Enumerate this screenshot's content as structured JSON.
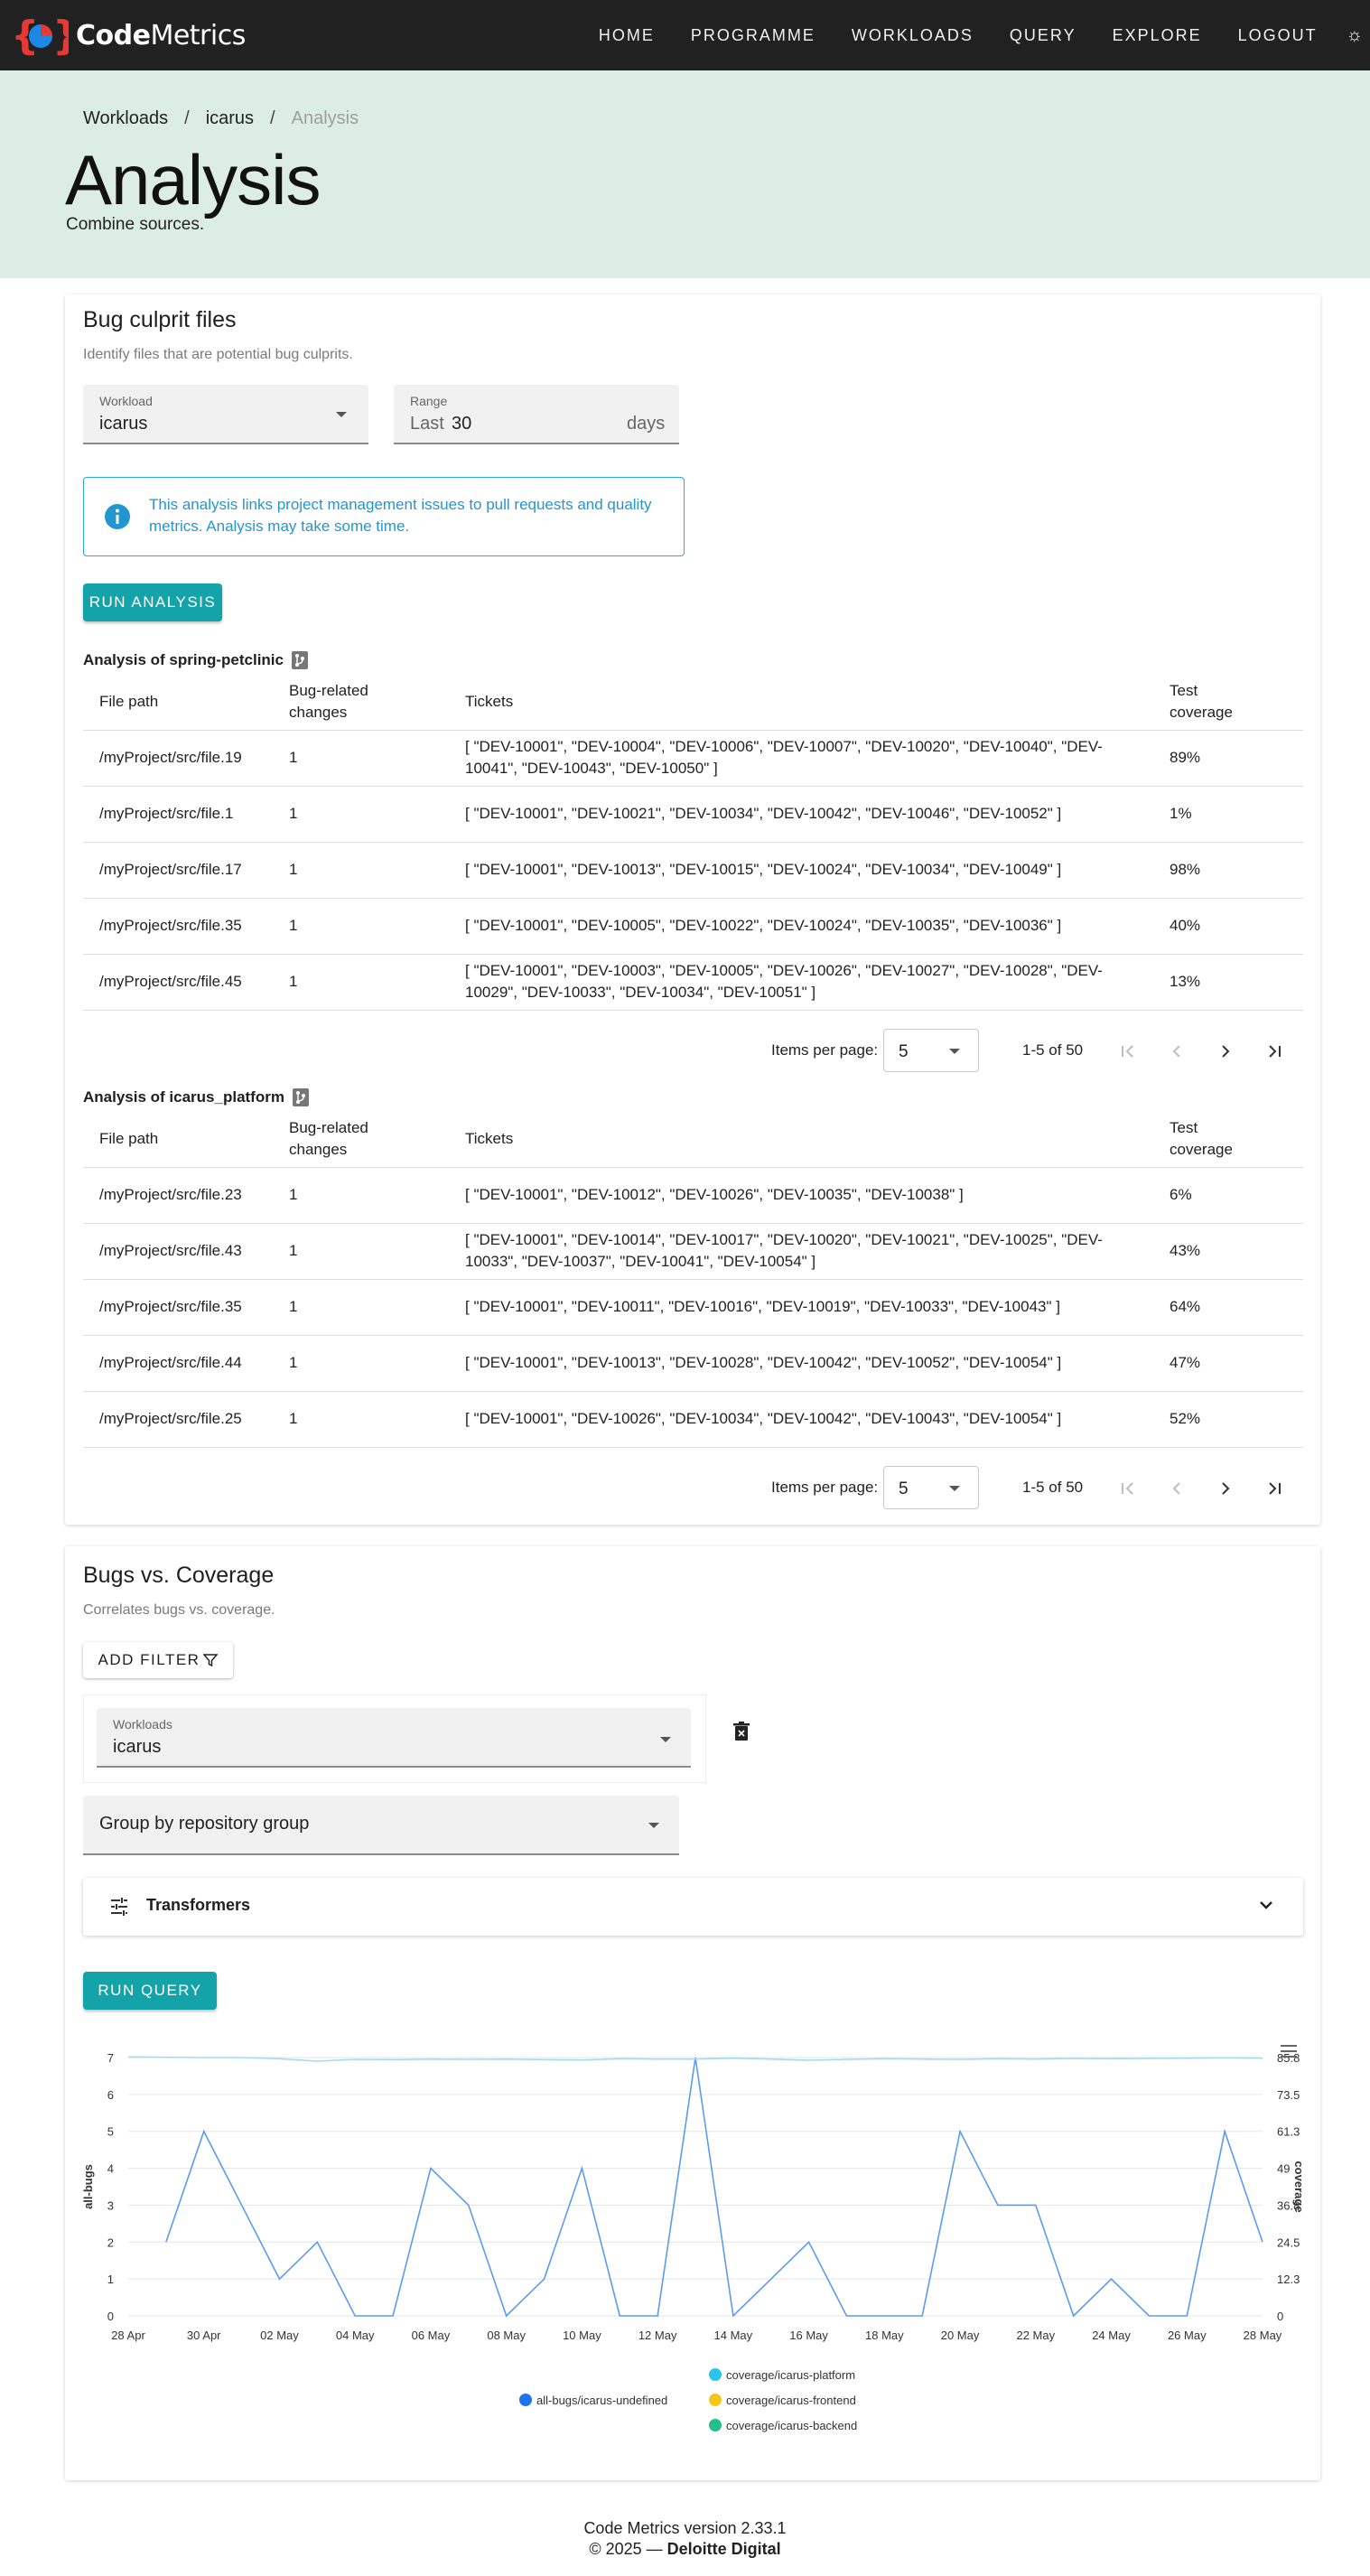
{
  "nav": {
    "brand": "CodeMetrics",
    "brand_bold": "Code",
    "brand_light": "Metrics",
    "links": [
      "HOME",
      "PROGRAMME",
      "WORKLOADS",
      "QUERY",
      "EXPLORE",
      "LOGOUT"
    ],
    "theme_icon": "sun-icon"
  },
  "breadcrumb": [
    "Workloads",
    "icarus",
    "Analysis"
  ],
  "page": {
    "title": "Analysis",
    "subtitle": "Combine sources."
  },
  "bug_culprit": {
    "title": "Bug culprit files",
    "subtitle": "Identify files that are potential bug culprits.",
    "workload": {
      "label": "Workload",
      "value": "icarus"
    },
    "range": {
      "label": "Range",
      "prefix": "Last",
      "value": "30",
      "suffix": "days"
    },
    "info": "This analysis links project management issues to pull requests and quality metrics. Analysis may take some time.",
    "run_label": "RUN ANALYSIS",
    "columns": {
      "path": "File path",
      "bug_line1": "Bug-related",
      "bug_line2": "changes",
      "tickets": "Tickets",
      "cov_line1": "Test",
      "cov_line2": "coverage"
    },
    "tables": [
      {
        "title": "Analysis of spring-petclinic",
        "rows": [
          {
            "path": "/myProject/src/file.19",
            "bugs": "1",
            "tickets": "[ \"DEV-10001\", \"DEV-10004\", \"DEV-10006\", \"DEV-10007\", \"DEV-10020\", \"DEV-10040\", \"DEV-10041\", \"DEV-10043\", \"DEV-10050\" ]",
            "coverage": "89%"
          },
          {
            "path": "/myProject/src/file.1",
            "bugs": "1",
            "tickets": "[ \"DEV-10001\", \"DEV-10021\", \"DEV-10034\", \"DEV-10042\", \"DEV-10046\", \"DEV-10052\" ]",
            "coverage": "1%"
          },
          {
            "path": "/myProject/src/file.17",
            "bugs": "1",
            "tickets": "[ \"DEV-10001\", \"DEV-10013\", \"DEV-10015\", \"DEV-10024\", \"DEV-10034\", \"DEV-10049\" ]",
            "coverage": "98%"
          },
          {
            "path": "/myProject/src/file.35",
            "bugs": "1",
            "tickets": "[ \"DEV-10001\", \"DEV-10005\", \"DEV-10022\", \"DEV-10024\", \"DEV-10035\", \"DEV-10036\" ]",
            "coverage": "40%"
          },
          {
            "path": "/myProject/src/file.45",
            "bugs": "1",
            "tickets": "[ \"DEV-10001\", \"DEV-10003\", \"DEV-10005\", \"DEV-10026\", \"DEV-10027\", \"DEV-10028\", \"DEV-10029\", \"DEV-10033\", \"DEV-10034\", \"DEV-10051\" ]",
            "coverage": "13%"
          }
        ],
        "pager": {
          "label": "Items per page:",
          "per_page": "5",
          "range": "1-5 of 50"
        }
      },
      {
        "title": "Analysis of icarus_platform",
        "rows": [
          {
            "path": "/myProject/src/file.23",
            "bugs": "1",
            "tickets": "[ \"DEV-10001\", \"DEV-10012\", \"DEV-10026\", \"DEV-10035\", \"DEV-10038\" ]",
            "coverage": "6%"
          },
          {
            "path": "/myProject/src/file.43",
            "bugs": "1",
            "tickets": "[ \"DEV-10001\", \"DEV-10014\", \"DEV-10017\", \"DEV-10020\", \"DEV-10021\", \"DEV-10025\", \"DEV-10033\", \"DEV-10037\", \"DEV-10041\", \"DEV-10054\" ]",
            "coverage": "43%"
          },
          {
            "path": "/myProject/src/file.35",
            "bugs": "1",
            "tickets": "[ \"DEV-10001\", \"DEV-10011\", \"DEV-10016\", \"DEV-10019\", \"DEV-10033\", \"DEV-10043\" ]",
            "coverage": "64%"
          },
          {
            "path": "/myProject/src/file.44",
            "bugs": "1",
            "tickets": "[ \"DEV-10001\", \"DEV-10013\", \"DEV-10028\", \"DEV-10042\", \"DEV-10052\", \"DEV-10054\" ]",
            "coverage": "47%"
          },
          {
            "path": "/myProject/src/file.25",
            "bugs": "1",
            "tickets": "[ \"DEV-10001\", \"DEV-10026\", \"DEV-10034\", \"DEV-10042\", \"DEV-10043\", \"DEV-10054\" ]",
            "coverage": "52%"
          }
        ],
        "pager": {
          "label": "Items per page:",
          "per_page": "5",
          "range": "1-5 of 50"
        }
      }
    ]
  },
  "bugs_coverage": {
    "title": "Bugs vs. Coverage",
    "subtitle": "Correlates bugs vs. coverage.",
    "add_filter_label": "ADD FILTER",
    "workloads": {
      "label": "Workloads",
      "value": "icarus"
    },
    "group_by": "Group by repository group",
    "transformers_label": "Transformers",
    "run_label": "RUN QUERY"
  },
  "chart_data": {
    "type": "line",
    "x": [
      "29 Apr",
      "30 Apr",
      "1 May",
      "2 May",
      "3 May",
      "4 May",
      "5 May",
      "6 May",
      "7 May",
      "8 May",
      "9 May",
      "10 May",
      "11 May",
      "12 May",
      "13 May",
      "14 May",
      "15 May",
      "16 May",
      "17 May",
      "18 May",
      "19 May",
      "20 May",
      "21 May",
      "22 May",
      "23 May",
      "24 May",
      "25 May",
      "26 May",
      "27 May",
      "28 May"
    ],
    "x_ticks": [
      "28 Apr",
      "30 Apr",
      "02 May",
      "04 May",
      "06 May",
      "08 May",
      "10 May",
      "12 May",
      "14 May",
      "16 May",
      "18 May",
      "20 May",
      "22 May",
      "24 May",
      "26 May",
      "28 May"
    ],
    "series": [
      {
        "name": "all-bugs/icarus-undefined",
        "axis": "left",
        "color": "#5b9bef",
        "values": [
          2,
          5,
          3,
          1,
          2,
          0,
          0,
          4,
          3,
          0,
          1,
          4,
          0,
          0,
          7,
          0,
          1,
          2,
          0,
          0,
          0,
          5,
          3,
          3,
          0,
          1,
          0,
          0,
          5,
          2
        ]
      },
      {
        "name": "coverage/icarus-platform",
        "axis": "right",
        "color": "#9fdcf0",
        "values": [
          86,
          85.8,
          85.8,
          85.4,
          84.6,
          85.2,
          85.1,
          85.3,
          85.2,
          85.3,
          85.1,
          85.0,
          85.4,
          85.3,
          85.3,
          85.6,
          85.3,
          84.9,
          85.2,
          85.4,
          85.3,
          85.2,
          85.4,
          85.3,
          85.5,
          85.4,
          85.5,
          85.6,
          85.7,
          85.6
        ]
      },
      {
        "name": "coverage/icarus-frontend",
        "axis": "right",
        "color": "#f4c20d",
        "values": []
      },
      {
        "name": "coverage/icarus-backend",
        "axis": "right",
        "color": "#22c08a",
        "values": []
      }
    ],
    "ylabel_left": "all-bugs",
    "ylabel_right": "coverage",
    "y_left_ticks": [
      "0",
      "1",
      "2",
      "3",
      "4",
      "5",
      "6",
      "7"
    ],
    "y_right_ticks": [
      "0",
      "12.3",
      "24.5",
      "36.8",
      "49",
      "61.3",
      "73.5",
      "85.8"
    ],
    "ylim_left": [
      0,
      7
    ],
    "ylim_right": [
      0,
      85.8
    ],
    "grid": true,
    "legend_colors": [
      "#1e74f0",
      "#2bc4ec",
      "#f5c518",
      "#22c08a"
    ],
    "legend": "bottom"
  },
  "footer": {
    "version": "Code Metrics version 2.33.1",
    "copyright": "© 2025 — ",
    "company": "Deloitte Digital"
  }
}
